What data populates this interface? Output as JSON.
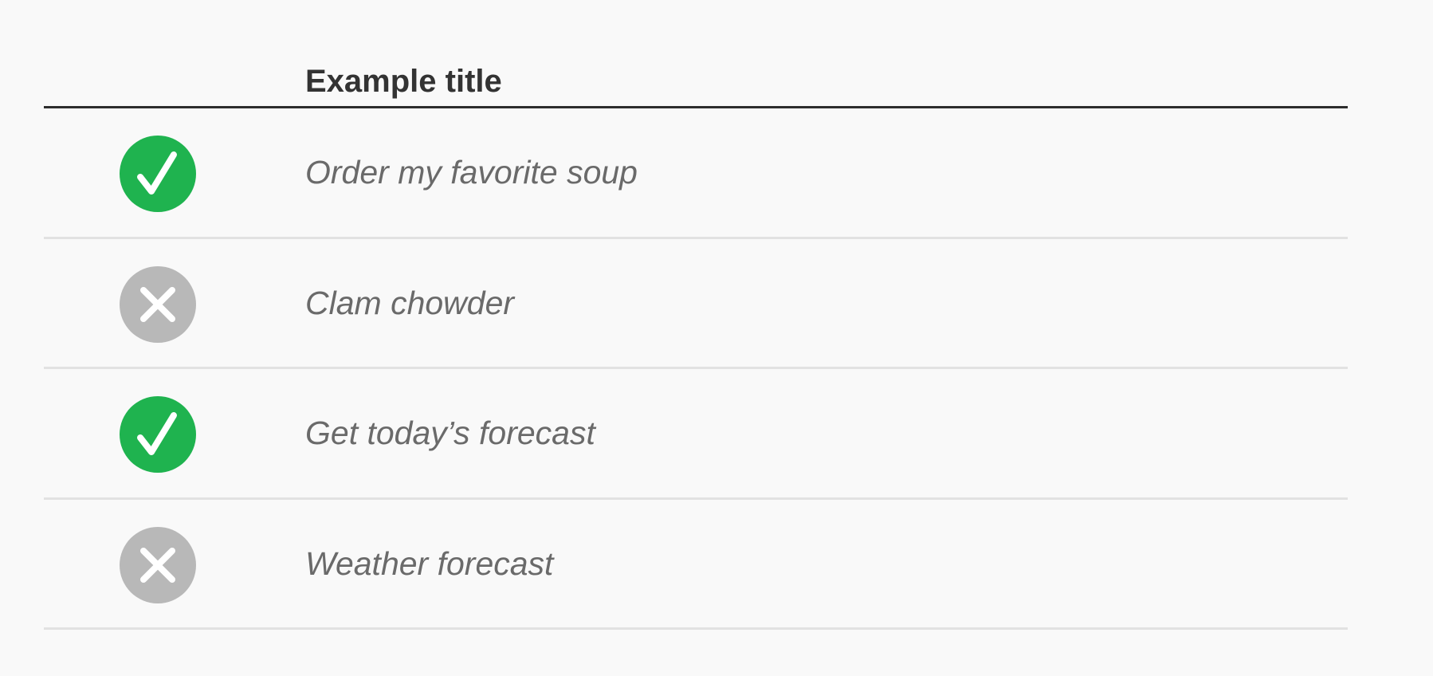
{
  "table": {
    "title": "Example title",
    "colors": {
      "success": "#1fb34f",
      "failure": "#b8b8b8",
      "rule_strong": "#2d2d2d",
      "rule_light": "#e2e2e2",
      "text": "#6a6a6a"
    },
    "rows": [
      {
        "status": "check",
        "icon": "checkmark-circle-icon",
        "text": "Order my favorite soup"
      },
      {
        "status": "cross",
        "icon": "x-circle-icon",
        "text": "Clam chowder"
      },
      {
        "status": "check",
        "icon": "checkmark-circle-icon",
        "text": "Get today’s forecast"
      },
      {
        "status": "cross",
        "icon": "x-circle-icon",
        "text": "Weather forecast"
      }
    ]
  }
}
